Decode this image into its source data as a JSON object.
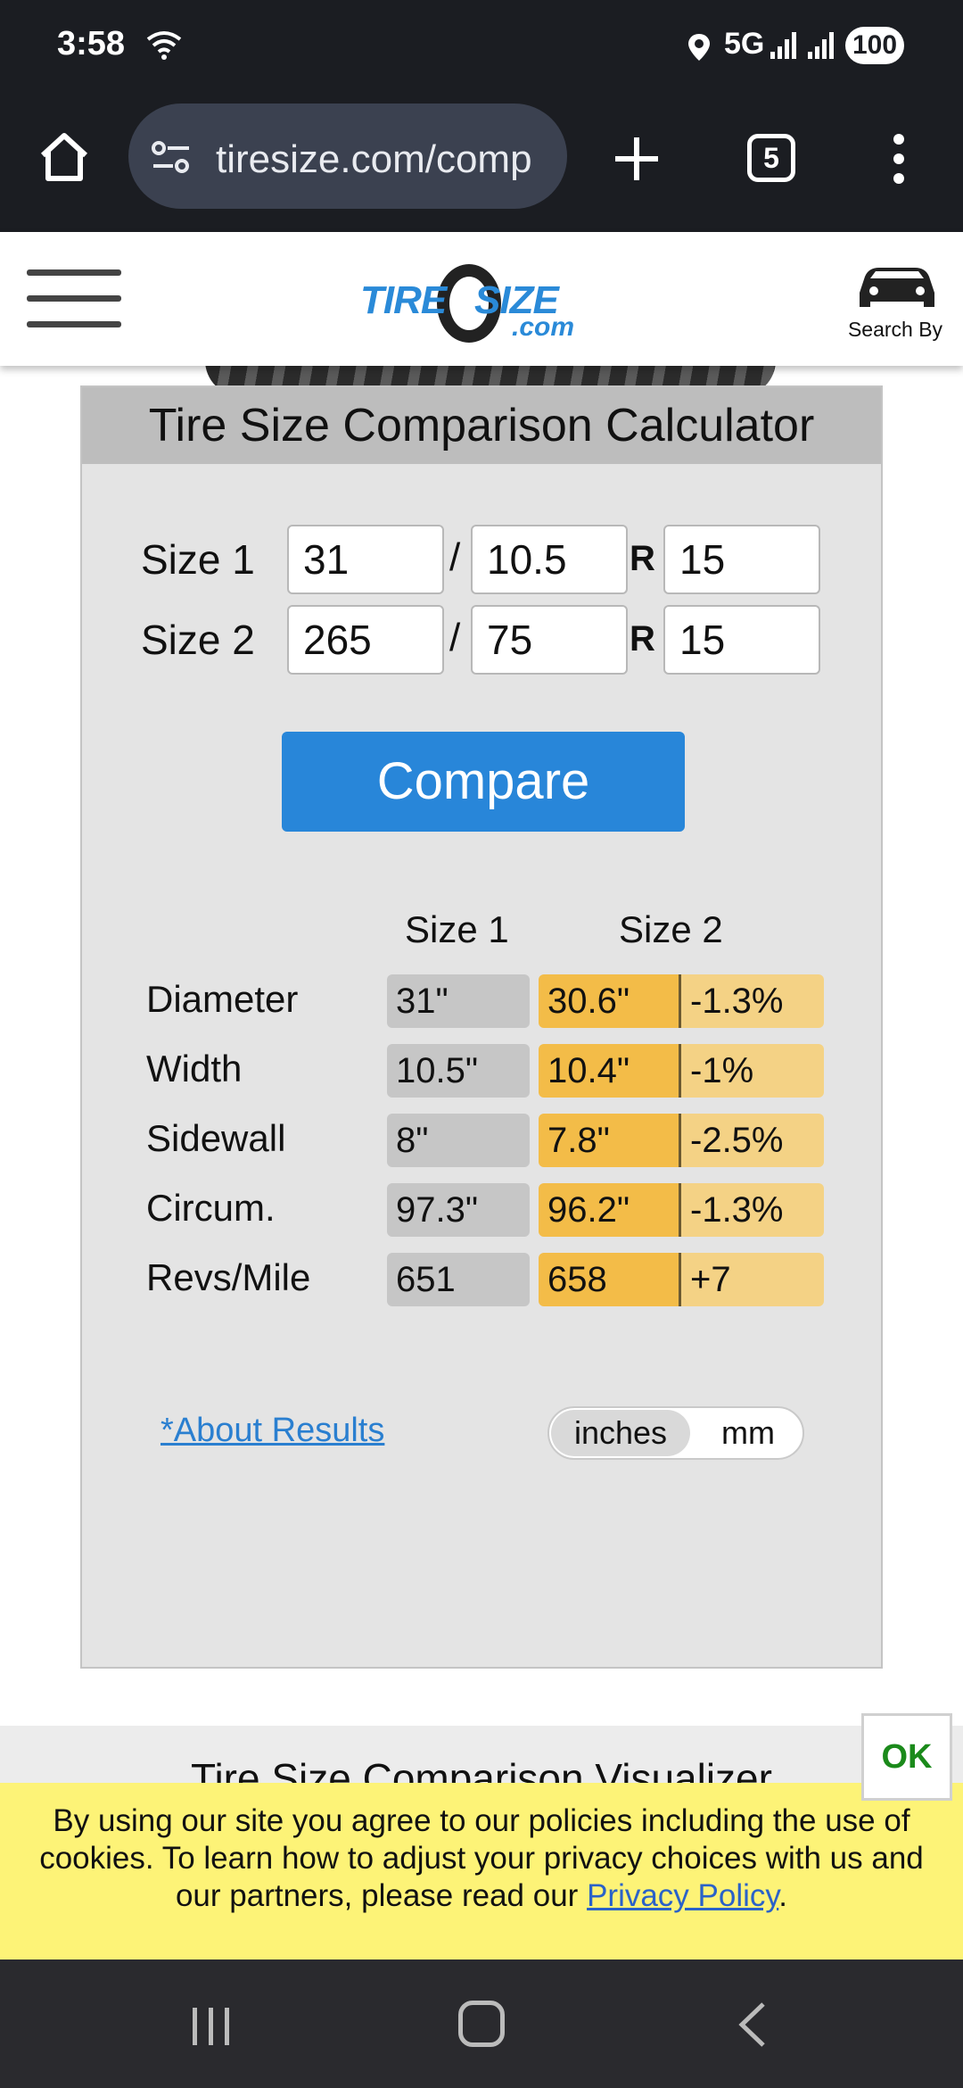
{
  "status_bar": {
    "time": "3:58",
    "network": "5G",
    "battery": "100"
  },
  "browser": {
    "url": "tiresize.com/comp",
    "tab_count": "5"
  },
  "site_header": {
    "logo_tire": "TIRE",
    "logo_size": "SIZE",
    "logo_com": ".com",
    "search_by_label": "Search By"
  },
  "calculator": {
    "title": "Tire Size Comparison Calculator",
    "size1": {
      "label": "Size 1",
      "width": "31",
      "aspect": "10.5",
      "rim": "15"
    },
    "size2": {
      "label": "Size 2",
      "width": "265",
      "aspect": "75",
      "rim": "15"
    },
    "slash": "/",
    "r_letter": "R",
    "compare_label": "Compare",
    "col_size1": "Size 1",
    "col_size2": "Size 2",
    "rows": [
      {
        "label": "Diameter",
        "size1": "31\"",
        "size2": "30.6\"",
        "diff": "-1.3%"
      },
      {
        "label": "Width",
        "size1": "10.5\"",
        "size2": "10.4\"",
        "diff": "-1%"
      },
      {
        "label": "Sidewall",
        "size1": "8\"",
        "size2": "7.8\"",
        "diff": "-2.5%"
      },
      {
        "label": "Circum.",
        "size1": "97.3\"",
        "size2": "96.2\"",
        "diff": "-1.3%"
      },
      {
        "label": "Revs/Mile",
        "size1": "651",
        "size2": "658",
        "diff": "+7"
      }
    ],
    "about_link": "*About Results",
    "unit_inches": "inches",
    "unit_mm": "mm",
    "selected_unit": "inches"
  },
  "visualizer": {
    "title": "Tire Size Comparison Visualizer"
  },
  "cookie_banner": {
    "text_before": "By using our site you agree to our policies including the use of cookies. To learn how to adjust your privacy choices with us and our partners, please read our ",
    "link": "Privacy Policy",
    "text_after": ".",
    "ok_label": "OK"
  },
  "colors": {
    "accent_blue": "#2886d9",
    "size2_cell": "#f3bc48",
    "diff_cell": "#f4d285",
    "size1_cell": "#c6c6c6",
    "cookie_bg": "#fdf377",
    "ok_green": "#1b8a1b"
  }
}
